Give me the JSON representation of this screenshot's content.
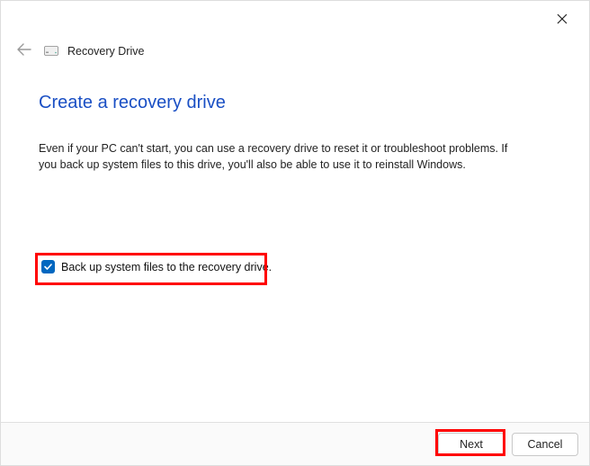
{
  "header": {
    "title": "Recovery Drive"
  },
  "main": {
    "heading": "Create a recovery drive",
    "description": "Even if your PC can't start, you can use a recovery drive to reset it or troubleshoot problems. If you back up system files to this drive, you'll also be able to use it to reinstall Windows."
  },
  "checkbox": {
    "label": "Back up system files to the recovery drive.",
    "checked": true
  },
  "footer": {
    "next_label": "Next",
    "cancel_label": "Cancel"
  }
}
